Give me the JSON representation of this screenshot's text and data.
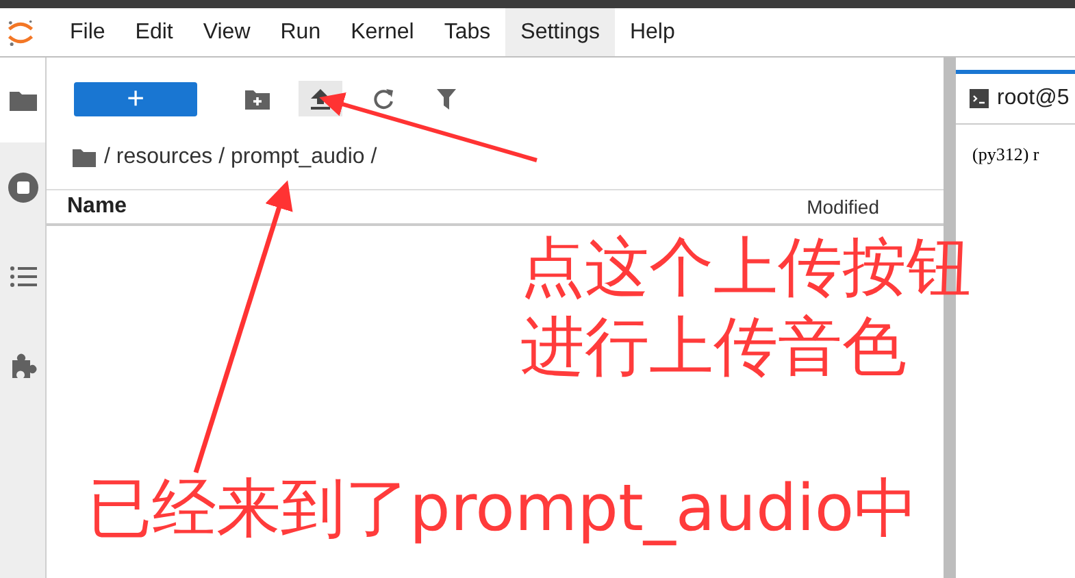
{
  "menu": [
    {
      "label": "File",
      "selected": false
    },
    {
      "label": "Edit",
      "selected": false
    },
    {
      "label": "View",
      "selected": false
    },
    {
      "label": "Run",
      "selected": false
    },
    {
      "label": "Kernel",
      "selected": false
    },
    {
      "label": "Tabs",
      "selected": false
    },
    {
      "label": "Settings",
      "selected": true
    },
    {
      "label": "Help",
      "selected": false
    }
  ],
  "sidebar": [
    {
      "kind": "folder",
      "selected": true
    },
    {
      "kind": "stop",
      "selected": false
    },
    {
      "kind": "list",
      "selected": false
    },
    {
      "kind": "puzzle",
      "selected": false
    }
  ],
  "file_browser": {
    "new_button": "+",
    "breadcrumb": "/ resources / prompt_audio /",
    "columns": [
      "Name",
      "Modified"
    ]
  },
  "terminal": {
    "tab": "root@5",
    "line": "(py312) r"
  },
  "annotations": [
    {
      "kind": "text",
      "text": "点这个上传按钮"
    },
    {
      "kind": "text",
      "text": "进行上传音色"
    },
    {
      "kind": "text",
      "text": "已经来到了prompt_audio中"
    }
  ]
}
